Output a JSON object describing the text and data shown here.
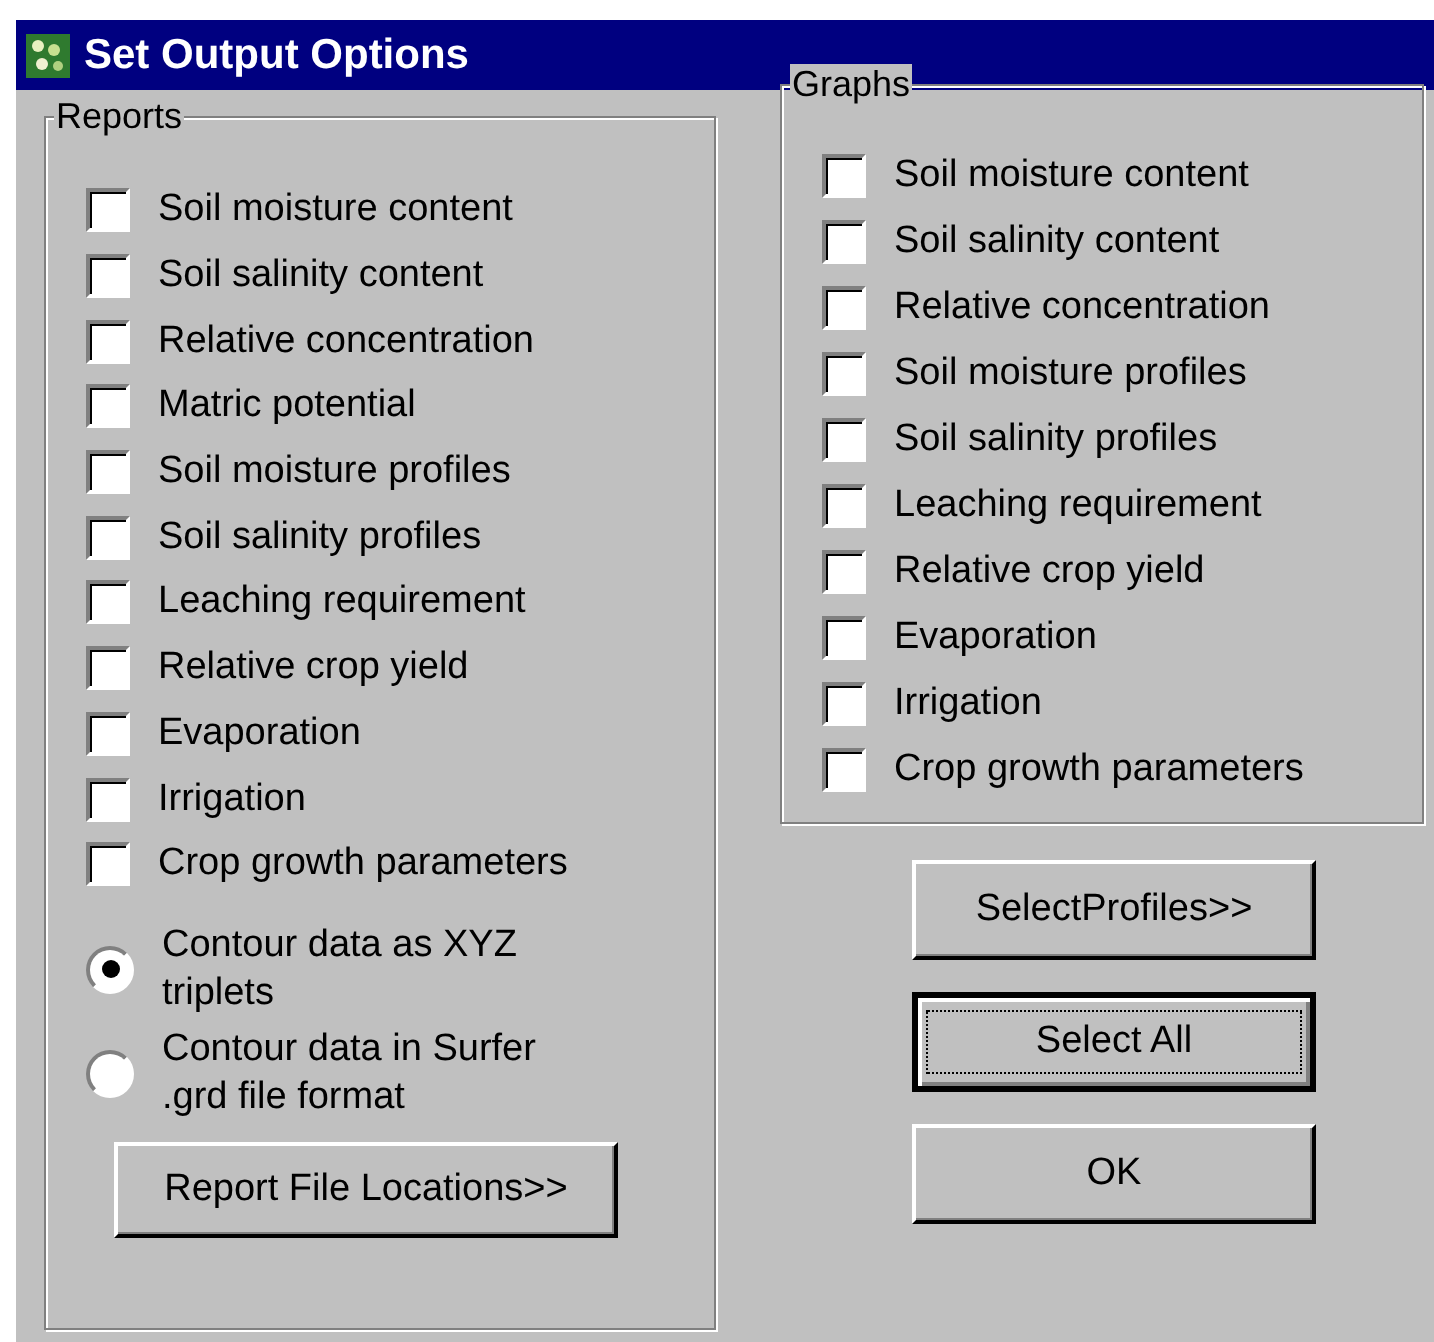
{
  "window": {
    "title": "Set Output Options"
  },
  "reports": {
    "label": "Reports",
    "items": [
      {
        "label": "Soil moisture content",
        "checked": false
      },
      {
        "label": "Soil salinity content",
        "checked": false
      },
      {
        "label": "Relative concentration",
        "checked": false
      },
      {
        "label": "Matric potential",
        "checked": false
      },
      {
        "label": "Soil moisture profiles",
        "checked": false
      },
      {
        "label": "Soil salinity profiles",
        "checked": false
      },
      {
        "label": "Leaching requirement",
        "checked": false
      },
      {
        "label": "Relative crop yield",
        "checked": false
      },
      {
        "label": "Evaporation",
        "checked": false
      },
      {
        "label": "Irrigation",
        "checked": false
      },
      {
        "label": "Crop growth parameters",
        "checked": false
      }
    ],
    "formats": [
      {
        "label": "Contour data as XYZ triplets",
        "selected": true
      },
      {
        "label": "Contour data in Surfer .grd file format",
        "selected": false
      }
    ],
    "button": {
      "label": "Report File Locations>>",
      "focused": false
    }
  },
  "graphs": {
    "label": "Graphs",
    "items": [
      {
        "label": "Soil moisture content",
        "checked": false
      },
      {
        "label": "Soil salinity content",
        "checked": false
      },
      {
        "label": "Relative concentration",
        "checked": false
      },
      {
        "label": "Soil moisture profiles",
        "checked": false
      },
      {
        "label": "Soil salinity profiles",
        "checked": false
      },
      {
        "label": "Leaching requirement",
        "checked": false
      },
      {
        "label": "Relative crop yield",
        "checked": false
      },
      {
        "label": "Evaporation",
        "checked": false
      },
      {
        "label": "Irrigation",
        "checked": false
      },
      {
        "label": "Crop growth parameters",
        "checked": false
      }
    ]
  },
  "buttons": [
    {
      "label": "SelectProfiles>>",
      "focused": false
    },
    {
      "label": "Select All",
      "focused": true
    },
    {
      "label": "OK",
      "focused": false
    }
  ]
}
